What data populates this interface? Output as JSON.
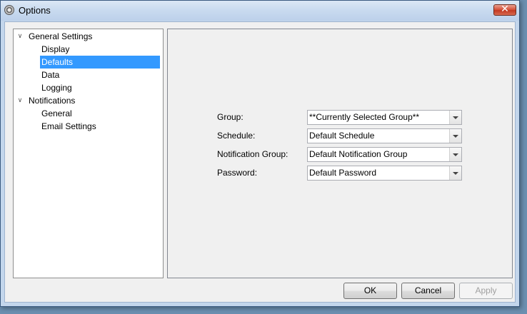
{
  "window": {
    "title": "Options",
    "close_symbol": "✕"
  },
  "tree": {
    "items": [
      {
        "label": "General Settings",
        "level": 0,
        "expanded": true
      },
      {
        "label": "Display",
        "level": 1
      },
      {
        "label": "Defaults",
        "level": 1,
        "selected": true
      },
      {
        "label": "Data",
        "level": 1
      },
      {
        "label": "Logging",
        "level": 1
      },
      {
        "label": "Notifications",
        "level": 0,
        "expanded": true
      },
      {
        "label": "General",
        "level": 1
      },
      {
        "label": "Email Settings",
        "level": 1
      }
    ],
    "expander_symbol": "∨"
  },
  "defaults_form": {
    "group": {
      "label": "Group:",
      "value": "**Currently Selected Group**"
    },
    "schedule": {
      "label": "Schedule:",
      "value": "Default Schedule"
    },
    "notification_group": {
      "label": "Notification Group:",
      "value": "Default Notification Group"
    },
    "password": {
      "label": "Password:",
      "value": "Default Password"
    }
  },
  "buttons": {
    "ok": "OK",
    "cancel": "Cancel",
    "apply": "Apply"
  },
  "colors": {
    "selection": "#3399ff",
    "title_bar": "#c8daef",
    "close_button": "#c94a33"
  }
}
